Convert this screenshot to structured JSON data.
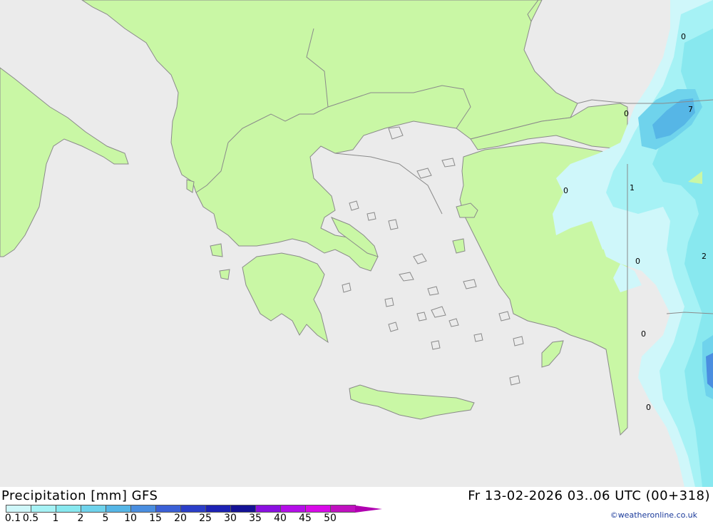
{
  "map": {
    "value_labels": [
      "0",
      "7",
      "0",
      "1",
      "0",
      "0",
      "2",
      "0",
      "0"
    ]
  },
  "footer": {
    "title": "Precipitation [mm] GFS",
    "datetime": "Fr 13-02-2026 03..06 UTC (00+318)",
    "credit": "©weatheronline.co.uk"
  },
  "legend": {
    "labels": [
      "0.1",
      "0.5",
      "1",
      "2",
      "5",
      "10",
      "15",
      "20",
      "25",
      "30",
      "35",
      "40",
      "45",
      "50"
    ],
    "colors": [
      "#cff7fa",
      "#a6f2f5",
      "#88e8ef",
      "#6fd3ec",
      "#56b6e6",
      "#4a8ee0",
      "#3b60d6",
      "#2b3ec8",
      "#1d22b4",
      "#141296",
      "#8a10e0",
      "#b40ee8",
      "#d80ae8",
      "#c010c0"
    ],
    "arrow_color": "#b000b0"
  },
  "colors": {
    "sea": "#ebebeb",
    "land": "#c9f7a5",
    "border": "#8a8a8a"
  }
}
